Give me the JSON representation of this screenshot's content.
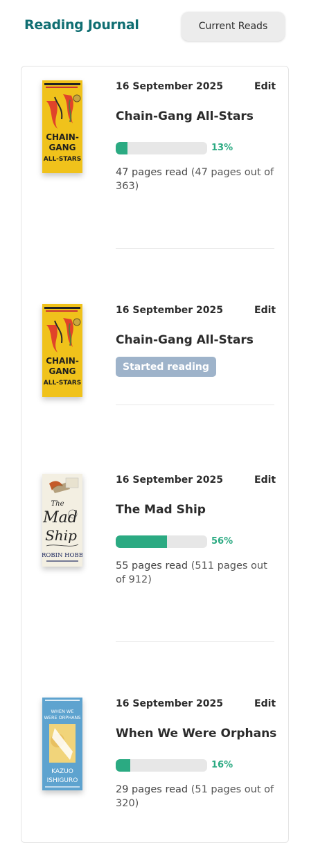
{
  "header": {
    "title": "Reading Journal",
    "current_reads_label": "Current Reads"
  },
  "entries": [
    {
      "date": "16 September 2025",
      "edit_label": "Edit",
      "title": "Chain-Gang All-Stars",
      "progress_percent": 13,
      "progress_label": "13%",
      "pages_read": "47 pages read",
      "pages_detail": "(47 pages out of 363)",
      "cover": {
        "author": "NANA KWAME ADJEI-BRENYAH",
        "title_lines": [
          "CHAIN-",
          "GANG",
          "ALL-STARS"
        ],
        "colors": {
          "bg": "#f0c21b",
          "accent": "#e0432a"
        }
      }
    },
    {
      "date": "16 September 2025",
      "edit_label": "Edit",
      "title": "Chain-Gang All-Stars",
      "status_badge": "Started reading",
      "cover": {
        "author": "NANA KWAME ADJEI-BRENYAH",
        "title_lines": [
          "CHAIN-",
          "GANG",
          "ALL-STARS"
        ],
        "colors": {
          "bg": "#f0c21b",
          "accent": "#e0432a"
        }
      }
    },
    {
      "date": "16 September 2025",
      "edit_label": "Edit",
      "title": "The Mad Ship",
      "progress_percent": 56,
      "progress_label": "56%",
      "pages_read": "55 pages read",
      "pages_detail": "(511 pages out of 912)",
      "cover": {
        "title_lines": [
          "The",
          "Mad",
          "Ship"
        ],
        "author": "ROBIN HOBB",
        "colors": {
          "bg": "#f3efe2",
          "accent": "#1f2a60"
        }
      }
    },
    {
      "date": "16 September 2025",
      "edit_label": "Edit",
      "title": "When We Were Orphans",
      "progress_percent": 16,
      "progress_label": "16%",
      "pages_read": "29 pages read",
      "pages_detail": "(51 pages out of 320)",
      "cover": {
        "title_lines": [
          "WHEN WE",
          "WERE ORPHANS"
        ],
        "author_lines": [
          "KAZUO",
          "ISHIGURO"
        ],
        "colors": {
          "bg": "#5ea3cf",
          "accent": "#f1d47a"
        }
      }
    }
  ],
  "colors": {
    "brand": "#0f6e72",
    "progress": "#2baa82",
    "badge": "#9eb3ca"
  }
}
